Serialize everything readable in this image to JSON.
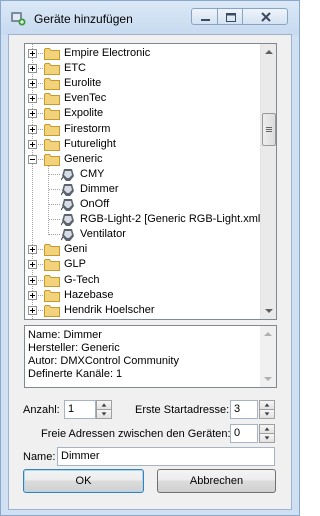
{
  "window": {
    "title": "Geräte hinzufügen"
  },
  "tree": {
    "items": [
      {
        "label": "Empire Electronic",
        "kind": "folder",
        "expanded": false
      },
      {
        "label": "ETC",
        "kind": "folder",
        "expanded": false
      },
      {
        "label": "Eurolite",
        "kind": "folder",
        "expanded": false
      },
      {
        "label": "EvenTec",
        "kind": "folder",
        "expanded": false
      },
      {
        "label": "Expolite",
        "kind": "folder",
        "expanded": false
      },
      {
        "label": "Firestorm",
        "kind": "folder",
        "expanded": false
      },
      {
        "label": "Futurelight",
        "kind": "folder",
        "expanded": false
      },
      {
        "label": "Generic",
        "kind": "folder",
        "expanded": true
      },
      {
        "label": "CMY",
        "kind": "device"
      },
      {
        "label": "Dimmer",
        "kind": "device"
      },
      {
        "label": "OnOff",
        "kind": "device"
      },
      {
        "label": "RGB-Light-2 [Generic RGB-Light.xml]",
        "kind": "device"
      },
      {
        "label": "Ventilator",
        "kind": "device"
      },
      {
        "label": "Geni",
        "kind": "folder",
        "expanded": false
      },
      {
        "label": "GLP",
        "kind": "folder",
        "expanded": false
      },
      {
        "label": "G-Tech",
        "kind": "folder",
        "expanded": false
      },
      {
        "label": "Hazebase",
        "kind": "folder",
        "expanded": false
      },
      {
        "label": "Hendrik Hoelscher",
        "kind": "folder",
        "expanded": false
      }
    ]
  },
  "info": {
    "lines": [
      "Name: Dimmer",
      "Hersteller: Generic",
      "Autor: DMXControl Community",
      "Definerte Kanäle: 1"
    ]
  },
  "form": {
    "anzahl_label": "Anzahl:",
    "anzahl_value": "1",
    "startadresse_label": "Erste Startadresse:",
    "startadresse_value": "3",
    "freie_label": "Freie Adressen zwischen den Geräten:",
    "freie_value": "0",
    "name_label": "Name:",
    "name_value": "Dimmer"
  },
  "buttons": {
    "ok": "OK",
    "cancel": "Abbrechen"
  },
  "colors": {
    "folder": "#f2d27a",
    "selection_frame": "#3c7fb1",
    "window_frame": "#cfe0f3"
  }
}
